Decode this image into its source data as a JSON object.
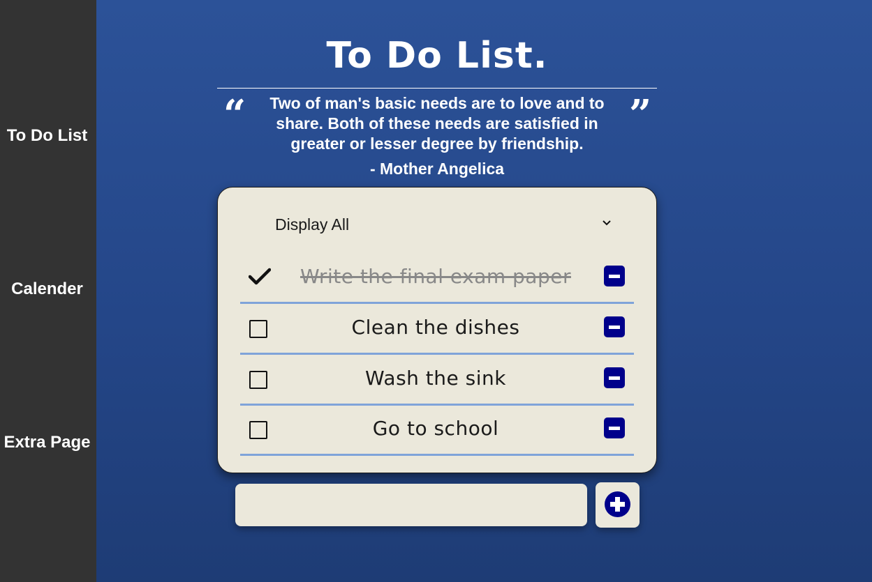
{
  "sidebar": {
    "items": [
      {
        "label": "To Do List"
      },
      {
        "label": "Calender"
      },
      {
        "label": "Extra Page"
      }
    ]
  },
  "header": {
    "title": "To Do List.",
    "quote": "Two of man's basic needs are to love and to share. Both of these needs are satisfied in greater or lesser degree by friendship.",
    "author": "- Mother Angelica"
  },
  "filter": {
    "selected": "Display All"
  },
  "todos": [
    {
      "text": "Write the final exam paper",
      "completed": true
    },
    {
      "text": "Clean the dishes",
      "completed": false
    },
    {
      "text": "Wash the sink",
      "completed": false
    },
    {
      "text": "Go to school",
      "completed": false
    }
  ],
  "new_todo": {
    "value": ""
  },
  "colors": {
    "accent": "#00008b",
    "card_background": "#ebe8db",
    "sidebar_background": "#333333",
    "row_divider": "#7fa3d9"
  },
  "icons": {
    "quote_open": "quote-open-icon",
    "quote_close": "quote-close-icon",
    "dropdown": "chevron-down-icon",
    "check": "check-icon",
    "delete": "minus-square-icon",
    "add": "plus-circle-icon"
  }
}
